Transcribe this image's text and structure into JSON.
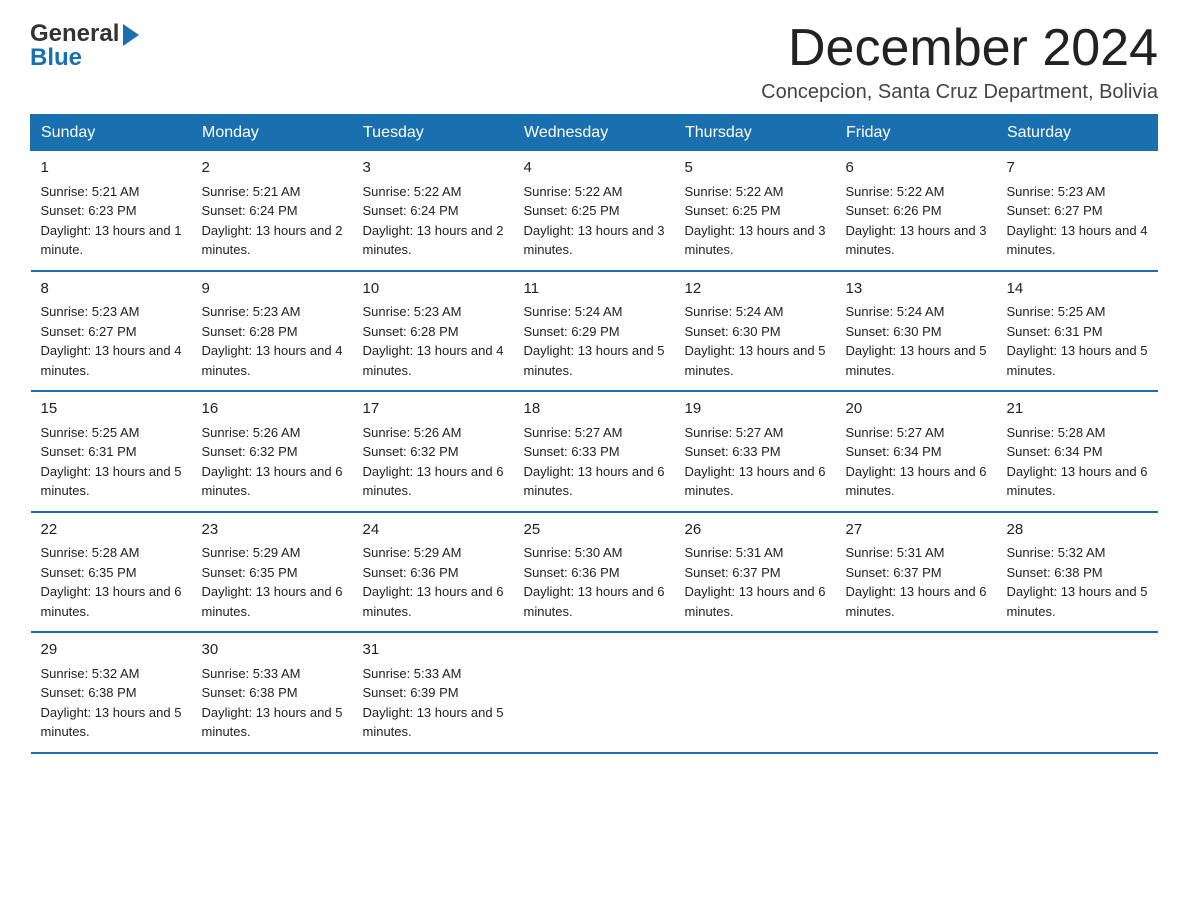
{
  "logo": {
    "general": "General",
    "blue": "Blue",
    "arrow": "▶"
  },
  "header": {
    "month_title": "December 2024",
    "subtitle": "Concepcion, Santa Cruz Department, Bolivia"
  },
  "weekdays": [
    "Sunday",
    "Monday",
    "Tuesday",
    "Wednesday",
    "Thursday",
    "Friday",
    "Saturday"
  ],
  "weeks": [
    [
      {
        "day": "1",
        "sunrise": "Sunrise: 5:21 AM",
        "sunset": "Sunset: 6:23 PM",
        "daylight": "Daylight: 13 hours and 1 minute."
      },
      {
        "day": "2",
        "sunrise": "Sunrise: 5:21 AM",
        "sunset": "Sunset: 6:24 PM",
        "daylight": "Daylight: 13 hours and 2 minutes."
      },
      {
        "day": "3",
        "sunrise": "Sunrise: 5:22 AM",
        "sunset": "Sunset: 6:24 PM",
        "daylight": "Daylight: 13 hours and 2 minutes."
      },
      {
        "day": "4",
        "sunrise": "Sunrise: 5:22 AM",
        "sunset": "Sunset: 6:25 PM",
        "daylight": "Daylight: 13 hours and 3 minutes."
      },
      {
        "day": "5",
        "sunrise": "Sunrise: 5:22 AM",
        "sunset": "Sunset: 6:25 PM",
        "daylight": "Daylight: 13 hours and 3 minutes."
      },
      {
        "day": "6",
        "sunrise": "Sunrise: 5:22 AM",
        "sunset": "Sunset: 6:26 PM",
        "daylight": "Daylight: 13 hours and 3 minutes."
      },
      {
        "day": "7",
        "sunrise": "Sunrise: 5:23 AM",
        "sunset": "Sunset: 6:27 PM",
        "daylight": "Daylight: 13 hours and 4 minutes."
      }
    ],
    [
      {
        "day": "8",
        "sunrise": "Sunrise: 5:23 AM",
        "sunset": "Sunset: 6:27 PM",
        "daylight": "Daylight: 13 hours and 4 minutes."
      },
      {
        "day": "9",
        "sunrise": "Sunrise: 5:23 AM",
        "sunset": "Sunset: 6:28 PM",
        "daylight": "Daylight: 13 hours and 4 minutes."
      },
      {
        "day": "10",
        "sunrise": "Sunrise: 5:23 AM",
        "sunset": "Sunset: 6:28 PM",
        "daylight": "Daylight: 13 hours and 4 minutes."
      },
      {
        "day": "11",
        "sunrise": "Sunrise: 5:24 AM",
        "sunset": "Sunset: 6:29 PM",
        "daylight": "Daylight: 13 hours and 5 minutes."
      },
      {
        "day": "12",
        "sunrise": "Sunrise: 5:24 AM",
        "sunset": "Sunset: 6:30 PM",
        "daylight": "Daylight: 13 hours and 5 minutes."
      },
      {
        "day": "13",
        "sunrise": "Sunrise: 5:24 AM",
        "sunset": "Sunset: 6:30 PM",
        "daylight": "Daylight: 13 hours and 5 minutes."
      },
      {
        "day": "14",
        "sunrise": "Sunrise: 5:25 AM",
        "sunset": "Sunset: 6:31 PM",
        "daylight": "Daylight: 13 hours and 5 minutes."
      }
    ],
    [
      {
        "day": "15",
        "sunrise": "Sunrise: 5:25 AM",
        "sunset": "Sunset: 6:31 PM",
        "daylight": "Daylight: 13 hours and 5 minutes."
      },
      {
        "day": "16",
        "sunrise": "Sunrise: 5:26 AM",
        "sunset": "Sunset: 6:32 PM",
        "daylight": "Daylight: 13 hours and 6 minutes."
      },
      {
        "day": "17",
        "sunrise": "Sunrise: 5:26 AM",
        "sunset": "Sunset: 6:32 PM",
        "daylight": "Daylight: 13 hours and 6 minutes."
      },
      {
        "day": "18",
        "sunrise": "Sunrise: 5:27 AM",
        "sunset": "Sunset: 6:33 PM",
        "daylight": "Daylight: 13 hours and 6 minutes."
      },
      {
        "day": "19",
        "sunrise": "Sunrise: 5:27 AM",
        "sunset": "Sunset: 6:33 PM",
        "daylight": "Daylight: 13 hours and 6 minutes."
      },
      {
        "day": "20",
        "sunrise": "Sunrise: 5:27 AM",
        "sunset": "Sunset: 6:34 PM",
        "daylight": "Daylight: 13 hours and 6 minutes."
      },
      {
        "day": "21",
        "sunrise": "Sunrise: 5:28 AM",
        "sunset": "Sunset: 6:34 PM",
        "daylight": "Daylight: 13 hours and 6 minutes."
      }
    ],
    [
      {
        "day": "22",
        "sunrise": "Sunrise: 5:28 AM",
        "sunset": "Sunset: 6:35 PM",
        "daylight": "Daylight: 13 hours and 6 minutes."
      },
      {
        "day": "23",
        "sunrise": "Sunrise: 5:29 AM",
        "sunset": "Sunset: 6:35 PM",
        "daylight": "Daylight: 13 hours and 6 minutes."
      },
      {
        "day": "24",
        "sunrise": "Sunrise: 5:29 AM",
        "sunset": "Sunset: 6:36 PM",
        "daylight": "Daylight: 13 hours and 6 minutes."
      },
      {
        "day": "25",
        "sunrise": "Sunrise: 5:30 AM",
        "sunset": "Sunset: 6:36 PM",
        "daylight": "Daylight: 13 hours and 6 minutes."
      },
      {
        "day": "26",
        "sunrise": "Sunrise: 5:31 AM",
        "sunset": "Sunset: 6:37 PM",
        "daylight": "Daylight: 13 hours and 6 minutes."
      },
      {
        "day": "27",
        "sunrise": "Sunrise: 5:31 AM",
        "sunset": "Sunset: 6:37 PM",
        "daylight": "Daylight: 13 hours and 6 minutes."
      },
      {
        "day": "28",
        "sunrise": "Sunrise: 5:32 AM",
        "sunset": "Sunset: 6:38 PM",
        "daylight": "Daylight: 13 hours and 5 minutes."
      }
    ],
    [
      {
        "day": "29",
        "sunrise": "Sunrise: 5:32 AM",
        "sunset": "Sunset: 6:38 PM",
        "daylight": "Daylight: 13 hours and 5 minutes."
      },
      {
        "day": "30",
        "sunrise": "Sunrise: 5:33 AM",
        "sunset": "Sunset: 6:38 PM",
        "daylight": "Daylight: 13 hours and 5 minutes."
      },
      {
        "day": "31",
        "sunrise": "Sunrise: 5:33 AM",
        "sunset": "Sunset: 6:39 PM",
        "daylight": "Daylight: 13 hours and 5 minutes."
      },
      null,
      null,
      null,
      null
    ]
  ]
}
